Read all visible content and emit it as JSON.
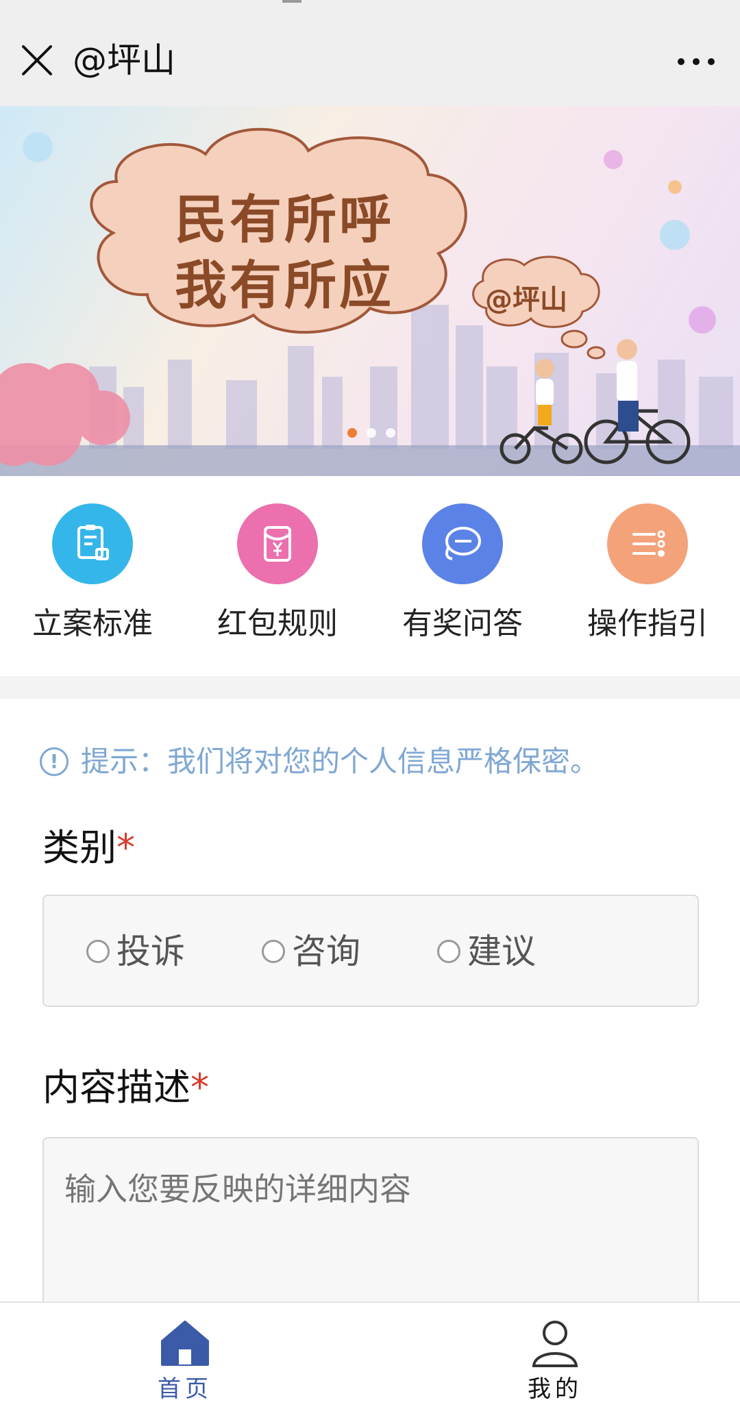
{
  "topbar": {
    "title": "@坪山",
    "close_icon": "close-icon",
    "more_icon": "more-icon"
  },
  "banner": {
    "line1": "民有所呼",
    "line2": "我有所应",
    "tag": "@坪山",
    "slides_total": 3,
    "active_slide": 1
  },
  "quick_actions": [
    {
      "label": "立案标准",
      "icon": "clipboard-stamp-icon",
      "color": "#35b6ea"
    },
    {
      "label": "红包规则",
      "icon": "red-envelope-icon",
      "color": "#ec6fae"
    },
    {
      "label": "有奖问答",
      "icon": "chat-bubbles-icon",
      "color": "#5b82e6"
    },
    {
      "label": "操作指引",
      "icon": "list-icon",
      "color": "#f4a27a"
    }
  ],
  "form": {
    "tip": "提示：我们将对您的个人信息严格保密。",
    "category_label": "类别",
    "required_mark": "*",
    "category_options": [
      "投诉",
      "咨询",
      "建议"
    ],
    "content_label": "内容描述",
    "content_placeholder": "输入您要反映的详细内容"
  },
  "tabbar": {
    "home": "首页",
    "mine": "我的",
    "active": "home",
    "active_color": "#3b5aa7"
  }
}
